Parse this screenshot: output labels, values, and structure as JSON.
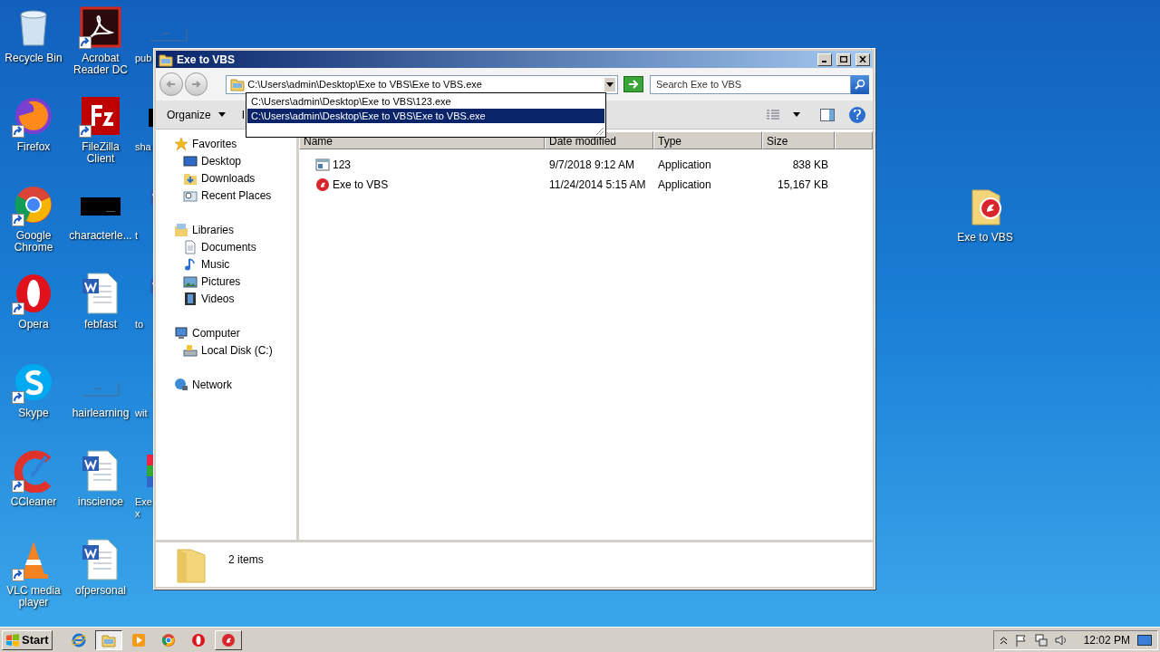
{
  "desktop": {
    "columns": [
      [
        {
          "label": "Recycle Bin",
          "kind": "recycle",
          "shortcut": false
        },
        {
          "label": "Firefox",
          "kind": "firefox",
          "shortcut": true
        },
        {
          "label": "Google Chrome",
          "kind": "chrome",
          "shortcut": true
        },
        {
          "label": "Opera",
          "kind": "opera",
          "shortcut": true
        },
        {
          "label": "Skype",
          "kind": "skype",
          "shortcut": true
        },
        {
          "label": "CCleaner",
          "kind": "ccleaner",
          "shortcut": true
        },
        {
          "label": "VLC media player",
          "kind": "vlc",
          "shortcut": true
        }
      ],
      [
        {
          "label": "Acrobat Reader DC",
          "kind": "acrobat",
          "shortcut": true
        },
        {
          "label": "FileZilla Client",
          "kind": "filezilla",
          "shortcut": true
        },
        {
          "label": "characterle...",
          "kind": "dark",
          "shortcut": false
        },
        {
          "label": "febfast",
          "kind": "word",
          "shortcut": false
        },
        {
          "label": "hairlearning",
          "kind": "blank",
          "shortcut": false
        },
        {
          "label": "inscience",
          "kind": "word",
          "shortcut": false
        },
        {
          "label": "ofpersonal",
          "kind": "word",
          "shortcut": false
        }
      ],
      [
        {
          "label": "pub",
          "kind": "blank",
          "shortcut": false
        },
        {
          "label": "sha",
          "kind": "dark",
          "shortcut": false
        },
        {
          "label": "t",
          "kind": "word",
          "shortcut": false
        },
        {
          "label": "to",
          "kind": "word",
          "shortcut": false
        },
        {
          "label": "wit",
          "kind": "blank",
          "shortcut": false
        },
        {
          "label": "Exe\nx",
          "kind": "colorful",
          "shortcut": false
        }
      ]
    ],
    "right_icons": [
      {
        "label": "Exe to VBS",
        "kind": "exefolder",
        "shortcut": false
      }
    ]
  },
  "window": {
    "title": "Exe to VBS",
    "address": {
      "value": "C:\\Users\\admin\\Desktop\\Exe to VBS\\Exe to VBS.exe",
      "suggestions": [
        {
          "text": "C:\\Users\\admin\\Desktop\\Exe to VBS\\123.exe",
          "selected": false
        },
        {
          "text": "C:\\Users\\admin\\Desktop\\Exe to VBS\\Exe to VBS.exe",
          "selected": true
        }
      ]
    },
    "search": {
      "placeholder": "Search Exe to VBS"
    },
    "toolbar": [
      {
        "label": "Organize",
        "kind": "menu"
      },
      {
        "label": "I",
        "kind": "plain"
      }
    ],
    "navigation": [
      {
        "label": "Favorites",
        "kind": "star",
        "children": [
          {
            "label": "Desktop",
            "kind": "desktop"
          },
          {
            "label": "Downloads",
            "kind": "downloads"
          },
          {
            "label": "Recent Places",
            "kind": "recent"
          }
        ]
      },
      {
        "label": "Libraries",
        "kind": "libraries",
        "children": [
          {
            "label": "Documents",
            "kind": "documents"
          },
          {
            "label": "Music",
            "kind": "music"
          },
          {
            "label": "Pictures",
            "kind": "pictures"
          },
          {
            "label": "Videos",
            "kind": "videos"
          }
        ]
      },
      {
        "label": "Computer",
        "kind": "computer",
        "children": [
          {
            "label": "Local Disk (C:)",
            "kind": "disk"
          }
        ]
      },
      {
        "label": "Network",
        "kind": "network"
      }
    ],
    "columns": [
      "Name",
      "Date modified",
      "Type",
      "Size"
    ],
    "files": [
      {
        "name": "123",
        "kind": "app",
        "date": "9/7/2018 9:12 AM",
        "type": "Application",
        "size": "838 KB"
      },
      {
        "name": "Exe to VBS",
        "kind": "exevbs",
        "date": "11/24/2014 5:15 AM",
        "type": "Application",
        "size": "15,167 KB"
      }
    ],
    "details": {
      "count": "2 items"
    }
  },
  "taskbar": {
    "start": "Start",
    "items": [
      {
        "kind": "ie",
        "active": false,
        "running": false
      },
      {
        "kind": "explorer",
        "active": true,
        "running": true
      },
      {
        "kind": "media",
        "active": false,
        "running": false
      },
      {
        "kind": "chrome",
        "active": false,
        "running": false
      },
      {
        "kind": "opera",
        "active": false,
        "running": false
      },
      {
        "kind": "exevbs",
        "active": false,
        "running": true
      }
    ],
    "clock": "12:02 PM"
  }
}
